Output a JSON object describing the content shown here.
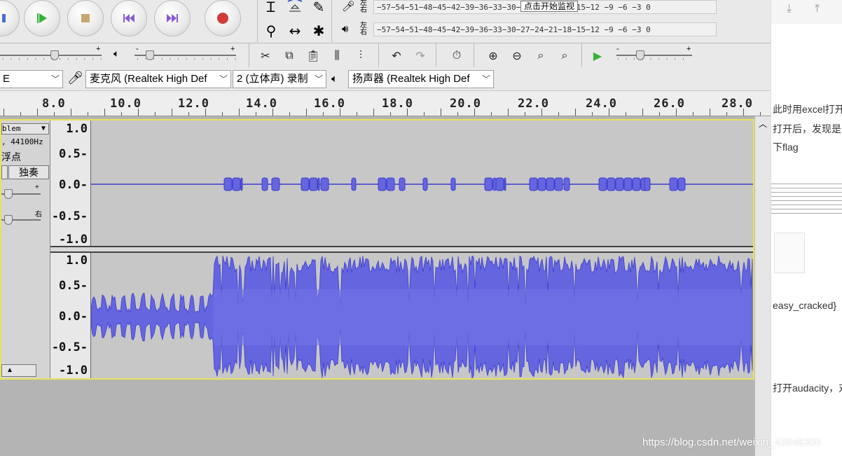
{
  "app": {
    "monitor_button": "点击开始监视",
    "record_meter_lr": [
      "左",
      "右"
    ],
    "playback_meter_lr": [
      "左",
      "右"
    ],
    "record_meter_scale": "−57−54−51−48−45−42−39−36−33−30−27−24−21−18−15−12 −9  −6  −3  0",
    "playback_meter_scale": "−57−54−51−48−45−42−39−36−33−30−27−24−21−18−15−12 −9  −6  −3  0",
    "slider_plus": "+",
    "slider_minus": "-"
  },
  "devices": {
    "host_partial": "E",
    "microphone": "麦克风 (Realtek High Def",
    "channels": "2 (立体声) 录制",
    "speaker": "扬声器 (Realtek High Def"
  },
  "ruler": {
    "labels": [
      "8.0",
      "10.0",
      "12.0",
      "14.0",
      "16.0",
      "18.0",
      "20.0",
      "22.0",
      "24.0",
      "26.0",
      "28.0"
    ]
  },
  "track": {
    "name_partial": "blem",
    "info_rate": ", 44100Hz",
    "info_format": "浮点",
    "solo_label": "独奏",
    "vruler_labels_top": [
      "1.0",
      "0.5-",
      "0.0-",
      "-0.5-",
      "-1.0"
    ],
    "vruler_labels_bottom": [
      "1.0",
      "0.5-",
      "0.0-",
      "-0.5-",
      "-1.0"
    ]
  },
  "blog": {
    "line1": "此时用excel打开",
    "line2": "打开后，发现是",
    "line3": "下flag",
    "line4": "easy_cracked}",
    "line5": "打开audacity，对"
  },
  "watermark": "https://blog.csdn.net/weixin_43848306",
  "colors": {
    "waveform": "#3d3dcc",
    "waveform_fill": "#6565e0",
    "track_bg": "#c7c7c7",
    "selection_border": "#e8e35a",
    "play_green": "#33b533",
    "record_red": "#d23a3a"
  }
}
